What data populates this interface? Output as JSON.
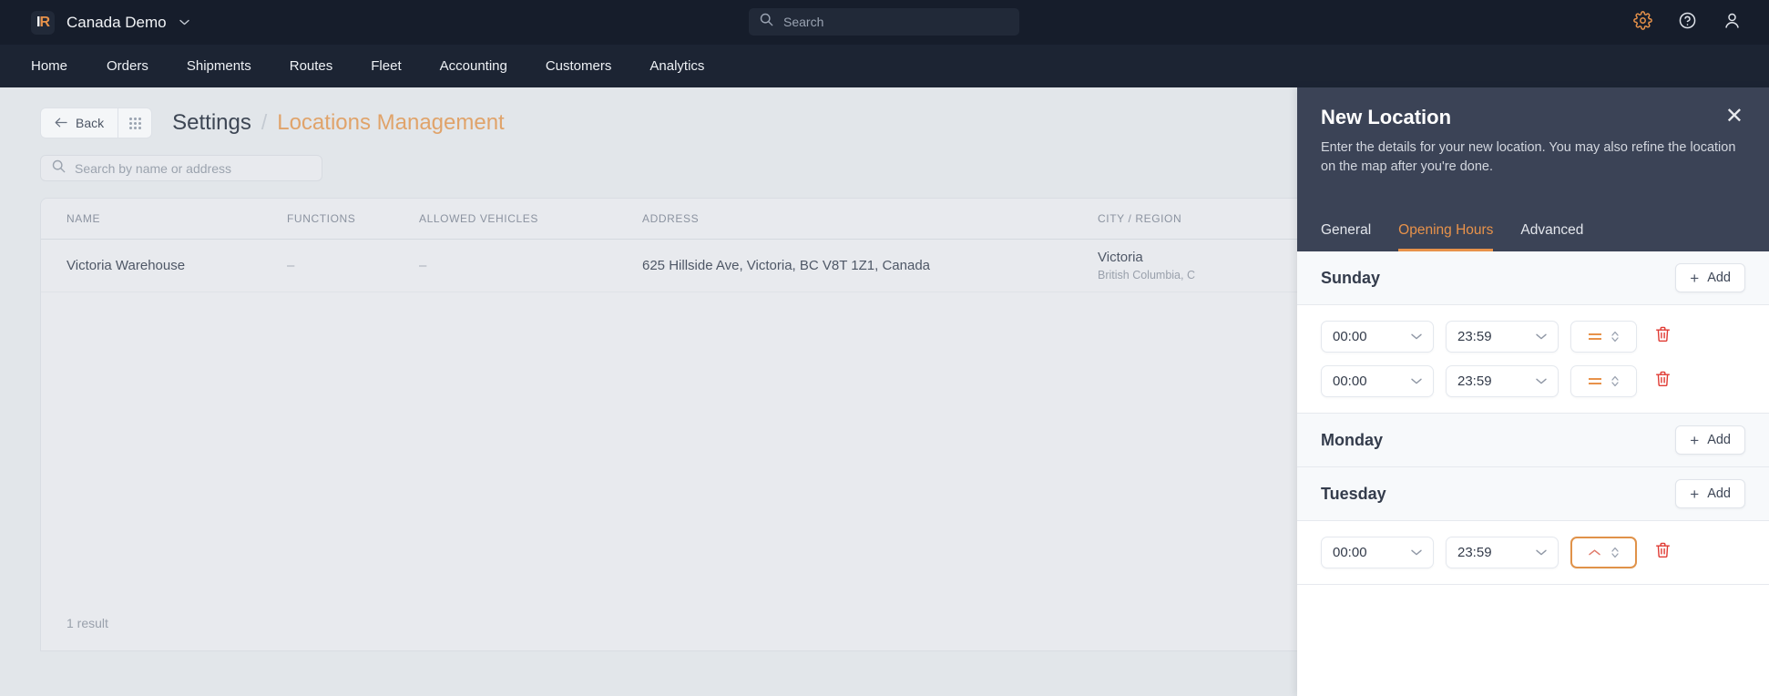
{
  "topbar": {
    "logo_letter": "R",
    "logo_name": "logo-icon",
    "org_name": "Canada Demo",
    "org_caret": "⌄",
    "search_placeholder": "Search",
    "search_value": "",
    "icons": [
      "gear-icon",
      "help-icon",
      "user-icon"
    ]
  },
  "nav": {
    "items": [
      {
        "label": "Home"
      },
      {
        "label": "Orders"
      },
      {
        "label": "Shipments"
      },
      {
        "label": "Routes"
      },
      {
        "label": "Fleet"
      },
      {
        "label": "Accounting"
      },
      {
        "label": "Customers"
      },
      {
        "label": "Analytics"
      }
    ]
  },
  "page": {
    "back_label": "Back",
    "breadcrumb_root": "Settings",
    "breadcrumb_sep": "/",
    "breadcrumb_current": "Locations Management",
    "search_placeholder": "Search by name or address",
    "search_value": "",
    "result_count": "1 result"
  },
  "table": {
    "columns": [
      "NAME",
      "FUNCTIONS",
      "ALLOWED VEHICLES",
      "ADDRESS",
      "CITY / REGION"
    ],
    "rows": [
      {
        "name": "Victoria Warehouse",
        "functions": "–",
        "allowed_vehicles": "–",
        "address": "625 Hillside Ave, Victoria, BC V8T 1Z1, Canada",
        "city": "Victoria",
        "region": "British Columbia, C"
      }
    ]
  },
  "panel": {
    "title": "New Location",
    "description": "Enter the details for your new location. You may also refine the location on the map after you're done.",
    "close_label": "✕",
    "tabs": [
      {
        "label": "General",
        "active": false
      },
      {
        "label": "Opening Hours",
        "active": true
      },
      {
        "label": "Advanced",
        "active": false
      }
    ],
    "add_label": "Add",
    "add_plus": "+",
    "accent_color": "#e8924a",
    "days": [
      {
        "name": "Sunday",
        "rows": [
          {
            "start": "00:00",
            "end": "23:59",
            "mode": "equal",
            "focused": false
          },
          {
            "start": "00:00",
            "end": "23:59",
            "mode": "equal",
            "focused": false
          }
        ]
      },
      {
        "name": "Monday",
        "rows": []
      },
      {
        "name": "Tuesday",
        "rows": [
          {
            "start": "00:00",
            "end": "23:59",
            "mode": "caret-up",
            "focused": true
          }
        ]
      }
    ]
  }
}
